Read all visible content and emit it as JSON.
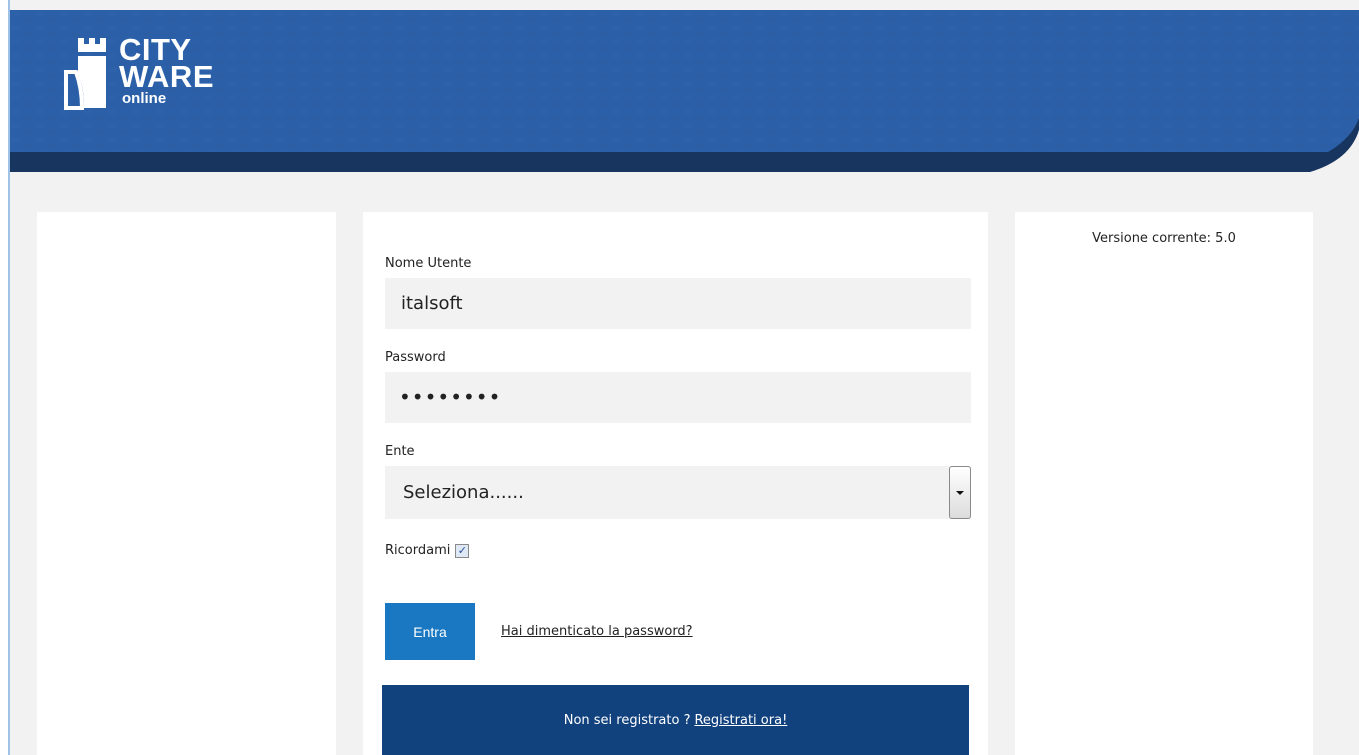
{
  "brand": {
    "logo_icon": "tower-icon",
    "line1": "CITY",
    "line2": "WARE",
    "line3": "online"
  },
  "colors": {
    "header_blue": "#2a5fa8",
    "header_dark": "#17355f",
    "primary_button": "#1a78c2",
    "register_bar": "#12427e",
    "background": "#f2f2f2"
  },
  "info": {
    "version": "Versione corrente: 5.0"
  },
  "login": {
    "username_label": "Nome Utente",
    "username_value": "italsoft",
    "password_label": "Password",
    "password_value": "••••••••",
    "ente_label": "Ente",
    "ente_selected": "Seleziona......",
    "remember_label": "Ricordami",
    "remember_checked": true,
    "enter_button": "Entra",
    "forgot_link": "Hai dimenticato la password?"
  },
  "register": {
    "text": "Non sei registrato ?",
    "link": "Registrati ora!"
  }
}
